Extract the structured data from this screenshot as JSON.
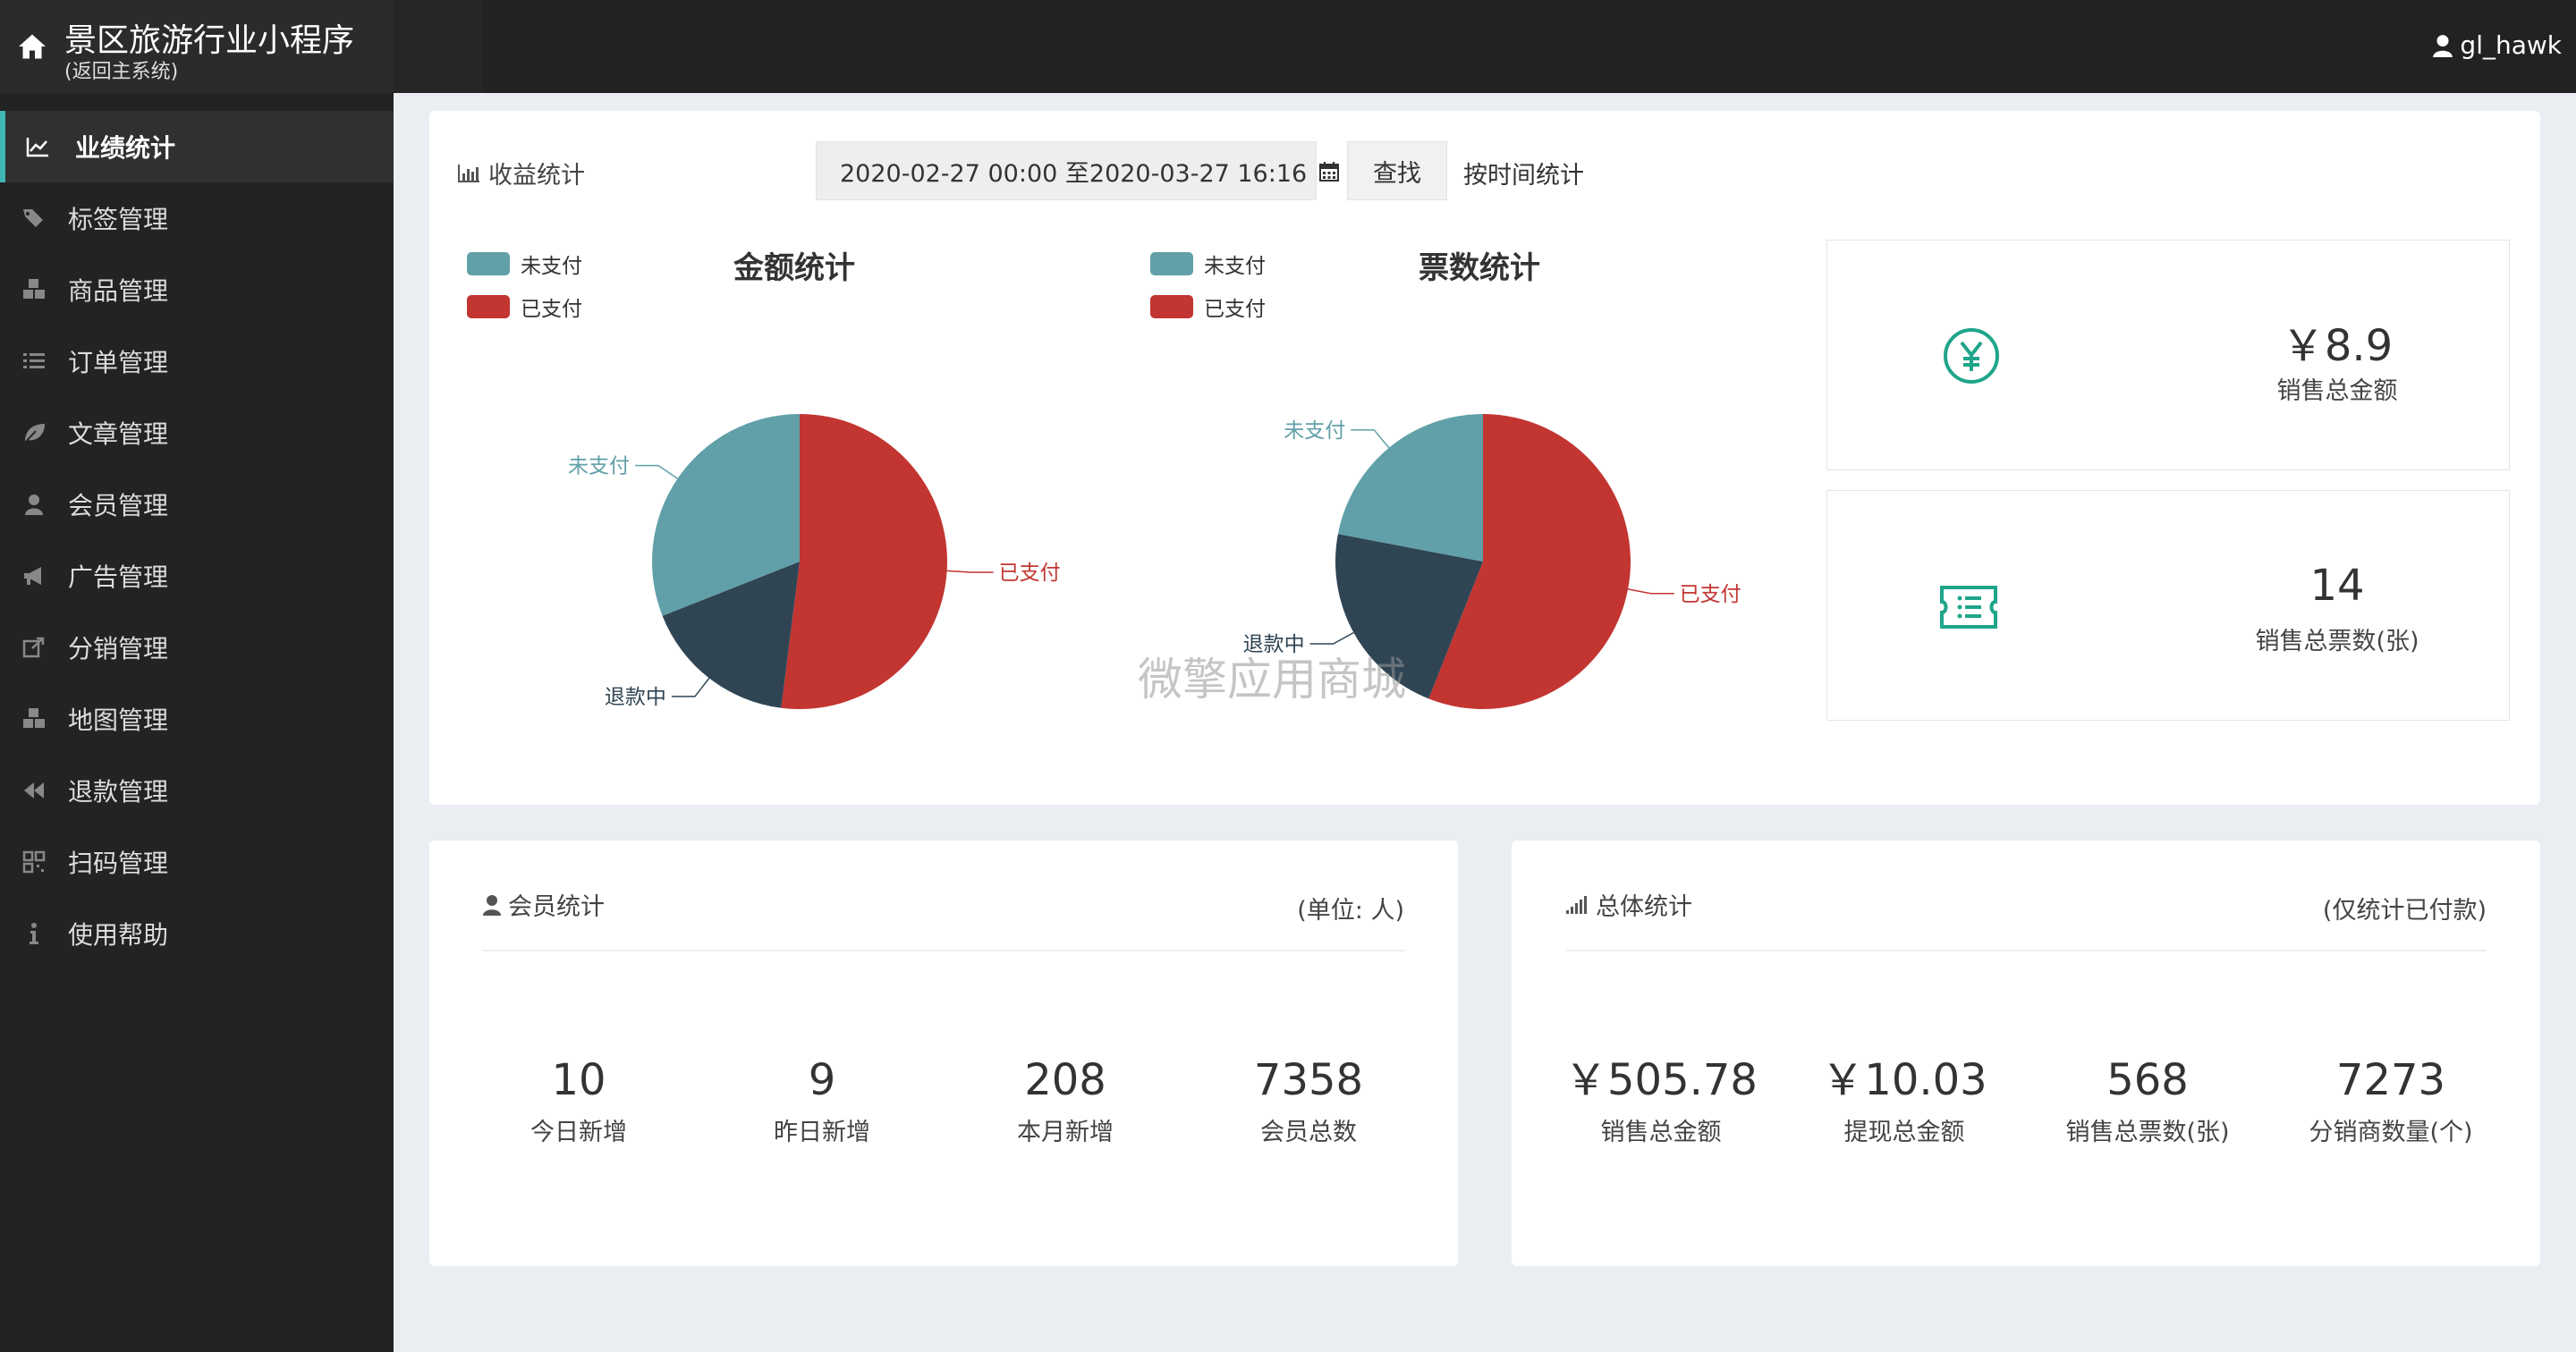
{
  "header": {
    "app_title": "景区旅游行业小程序",
    "app_subtitle": "(返回主系统)",
    "username": "gl_hawk"
  },
  "sidebar": {
    "items": [
      {
        "label": "业绩统计",
        "icon": "line-chart-icon",
        "active": true
      },
      {
        "label": "标签管理",
        "icon": "tags-icon"
      },
      {
        "label": "商品管理",
        "icon": "cubes-icon"
      },
      {
        "label": "订单管理",
        "icon": "list-icon"
      },
      {
        "label": "文章管理",
        "icon": "leaf-icon"
      },
      {
        "label": "会员管理",
        "icon": "user-icon"
      },
      {
        "label": "广告管理",
        "icon": "bullhorn-icon"
      },
      {
        "label": "分销管理",
        "icon": "share-icon"
      },
      {
        "label": "地图管理",
        "icon": "cubes-icon"
      },
      {
        "label": "退款管理",
        "icon": "backward-icon"
      },
      {
        "label": "扫码管理",
        "icon": "qrcode-icon"
      },
      {
        "label": "使用帮助",
        "icon": "info-icon"
      }
    ]
  },
  "revenue": {
    "section_title": "收益统计",
    "date_range": "2020-02-27 00:00 至2020-03-27 16:16",
    "search_label": "查找",
    "time_stat_label": "按时间统计"
  },
  "chart_data": [
    {
      "type": "pie",
      "title": "金额统计",
      "legend": [
        "未支付",
        "已支付"
      ],
      "labels": [
        "已支付",
        "退款中",
        "未支付"
      ],
      "values": [
        52,
        17,
        31
      ],
      "colors": [
        "#c23531",
        "#2f4554",
        "#61a0a8"
      ]
    },
    {
      "type": "pie",
      "title": "票数统计",
      "legend": [
        "未支付",
        "已支付"
      ],
      "labels": [
        "已支付",
        "退款中",
        "未支付"
      ],
      "values": [
        56,
        22,
        22
      ],
      "colors": [
        "#c23531",
        "#2f4554",
        "#61a0a8"
      ]
    }
  ],
  "summary_boxes": [
    {
      "value": "￥8.9",
      "label": "销售总金额",
      "icon": "yen-icon"
    },
    {
      "value": "14",
      "label": "销售总票数(张)",
      "icon": "ticket-icon"
    }
  ],
  "members": {
    "section_title": "会员统计",
    "unit": "(单位: 人)",
    "metrics": [
      {
        "value": "10",
        "label": "今日新增"
      },
      {
        "value": "9",
        "label": "昨日新增"
      },
      {
        "value": "208",
        "label": "本月新增"
      },
      {
        "value": "7358",
        "label": "会员总数"
      }
    ]
  },
  "totals": {
    "section_title": "总体统计",
    "unit": "(仅统计已付款)",
    "metrics": [
      {
        "value": "￥505.78",
        "label": "销售总金额"
      },
      {
        "value": "￥10.03",
        "label": "提现总金额"
      },
      {
        "value": "568",
        "label": "销售总票数(张)"
      },
      {
        "value": "7273",
        "label": "分销商数量(个)"
      }
    ]
  },
  "watermark": "微擎应用商城"
}
